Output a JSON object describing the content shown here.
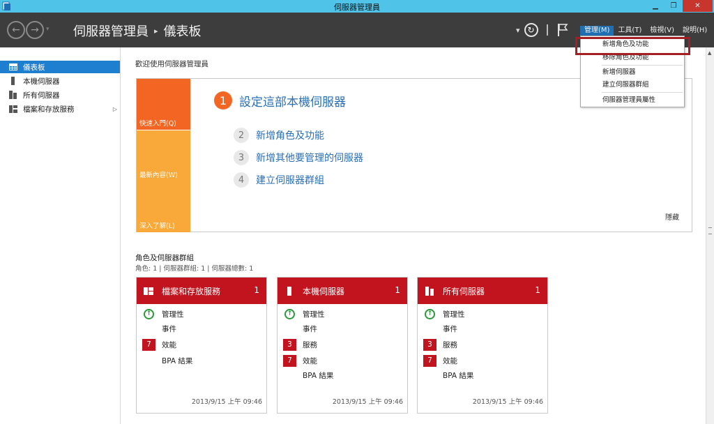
{
  "window": {
    "title": "伺服器管理員",
    "min_glyph": "▁",
    "restore_glyph": "❐",
    "close_glyph": "✕"
  },
  "header": {
    "breadcrumb_root": "伺服器管理員",
    "breadcrumb_sep": "▸",
    "breadcrumb_current": "儀表板",
    "caret": "▾",
    "menus": [
      "管理(M)",
      "工具(T)",
      "檢視(V)",
      "說明(H)"
    ]
  },
  "dropdown": {
    "items": [
      "新增角色及功能",
      "移除角色及功能",
      "新增伺服器",
      "建立伺服器群組",
      "伺服器管理員屬性"
    ]
  },
  "sidebar": {
    "items": [
      {
        "label": "儀表板",
        "active": true
      },
      {
        "label": "本機伺服器"
      },
      {
        "label": "所有伺服器"
      },
      {
        "label": "檔案和存放服務",
        "arrow": "▷"
      }
    ]
  },
  "welcome": {
    "title": "歡迎使用伺服器管理員",
    "tiles": [
      "快速入門(Q)",
      "最新內容(W)",
      "深入了解(L)"
    ],
    "steps": [
      {
        "num": "1",
        "text": "設定這部本機伺服器"
      },
      {
        "num": "2",
        "text": "新增角色及功能"
      },
      {
        "num": "3",
        "text": "新增其他要管理的伺服器"
      },
      {
        "num": "4",
        "text": "建立伺服器群組"
      }
    ],
    "hide": "隱藏"
  },
  "groups": {
    "title": "角色及伺服器群組",
    "subtitle": "角色: 1 | 伺服器群組: 1 | 伺服器總數: 1",
    "cards": [
      {
        "title": "檔案和存放服務",
        "count": "1",
        "rows": [
          {
            "type": "ok",
            "label": "管理性"
          },
          {
            "type": "none",
            "label": "事件"
          },
          {
            "type": "badge",
            "badge": "7",
            "label": "效能"
          },
          {
            "type": "none",
            "label": "BPA 結果"
          }
        ],
        "timestamp": "2013/9/15 上午 09:46"
      },
      {
        "title": "本機伺服器",
        "count": "1",
        "rows": [
          {
            "type": "ok",
            "label": "管理性"
          },
          {
            "type": "none",
            "label": "事件"
          },
          {
            "type": "badge",
            "badge": "3",
            "label": "服務"
          },
          {
            "type": "badge",
            "badge": "7",
            "label": "效能"
          },
          {
            "type": "none",
            "label": "BPA 結果"
          }
        ],
        "timestamp": "2013/9/15 上午 09:46"
      },
      {
        "title": "所有伺服器",
        "count": "1",
        "rows": [
          {
            "type": "ok",
            "label": "管理性"
          },
          {
            "type": "none",
            "label": "事件"
          },
          {
            "type": "badge",
            "badge": "3",
            "label": "服務"
          },
          {
            "type": "badge",
            "badge": "7",
            "label": "效能"
          },
          {
            "type": "none",
            "label": "BPA 結果"
          }
        ],
        "timestamp": "2013/9/15 上午 09:46"
      }
    ]
  },
  "colors": {
    "titlebar": "#4fc3e8",
    "header": "#3d3d3d",
    "accent_blue": "#1e7fd0",
    "card_red": "#c1141e",
    "orange": "#f26522",
    "light_orange": "#f8a93a",
    "highlight_box": "#a31f24"
  },
  "icons": {
    "ok_glyph": "↑",
    "refresh_glyph": "↻",
    "scroll_up": "▲"
  }
}
